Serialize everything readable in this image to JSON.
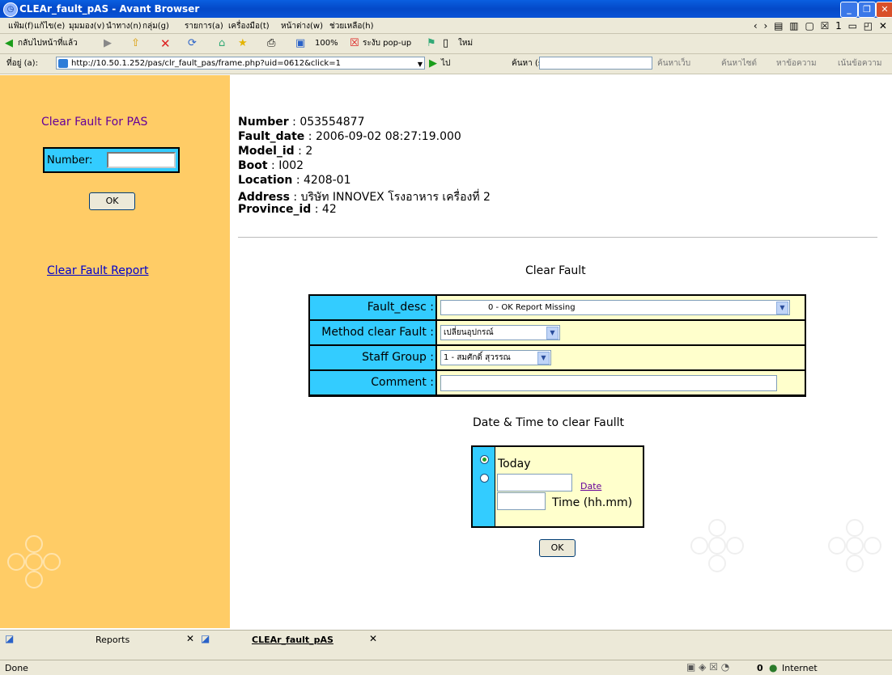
{
  "window": {
    "title": "CLEAr_fault_pAS - Avant Browser"
  },
  "menu": {
    "items": [
      "แฟ้ม(f)",
      "แก้ไข(e)",
      "มุมมอง(v)",
      "นำทาง(n)",
      "กลุ่ม(g)",
      "รายการ(a)",
      "เครื่องมือ(t)",
      "หน้าต่าง(w)",
      "ช่วยเหลือ(h)"
    ]
  },
  "toolbar": {
    "back_label": "กลับไปหน้าที่แล้ว",
    "zoom": "100%",
    "popup_label": "ระงับ pop-up",
    "new_label": "ใหม่"
  },
  "address": {
    "label": "ที่อยู่ (a):",
    "url": "http://10.50.1.252/pas/clr_fault_pas/frame.php?uid=0612&click=1",
    "go_label": "ไป",
    "search_label": "ค้นหา (s):",
    "web_search": "ค้นหาเว็บ",
    "site_search": "ค้นหาไซต์",
    "find_text": "หาข้อความ",
    "highlight": "เน้นข้อความ"
  },
  "sidebar": {
    "title": "Clear Fault For PAS",
    "number_label": "Number:",
    "number_value": "",
    "ok": "OK",
    "report_link": "Clear Fault Report"
  },
  "record": [
    {
      "label": "Number",
      "sep": " : ",
      "value": "053554877"
    },
    {
      "label": "Fault_date",
      "sep": " : ",
      "value": "2006-09-02 08:27:19.000"
    },
    {
      "label": "Model_id",
      "sep": " : ",
      "value": "2"
    },
    {
      "label": "Boot",
      "sep": " : ",
      "value": "I002"
    },
    {
      "label": "Location",
      "sep": " : ",
      "value": "4208-01"
    },
    {
      "label": "Address",
      "sep": " : ",
      "value": "บริษัท INNOVEX โรงอาหาร เครื่องที่ 2"
    },
    {
      "label": "Province_id",
      "sep": " : ",
      "value": "42"
    }
  ],
  "clear_fault": {
    "title": "Clear Fault",
    "fault_desc_label": "Fault_desc :",
    "fault_desc_value": "0 - OK Report Missing",
    "method_label": "Method clear Fault :",
    "method_value": "เปลี่ยนอุปกรณ์",
    "staff_label": "Staff Group :",
    "staff_value": "1 - สมศักดิ์ สุวรรณ",
    "comment_label": "Comment :",
    "comment_value": ""
  },
  "datetime": {
    "title": "Date & Time to clear Faullt",
    "today": "Today",
    "date_link": "Date",
    "time_label": "Time (hh.mm)",
    "ok": "OK"
  },
  "tabs": [
    {
      "label": "Reports"
    },
    {
      "label": "CLEAr_fault_pAS"
    }
  ],
  "status": {
    "left": "Done",
    "count": "0",
    "zone": "Internet"
  }
}
